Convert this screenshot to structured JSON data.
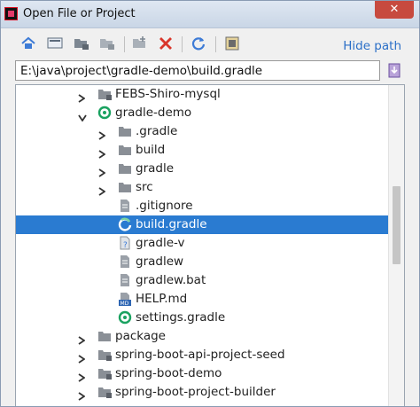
{
  "window": {
    "title": "Open File or Project",
    "close_symbol": "✕"
  },
  "toolbar": {
    "buttons": [
      {
        "name": "home-icon"
      },
      {
        "name": "desktop-icon"
      },
      {
        "name": "project-dir-icon"
      },
      {
        "name": "module-dir-icon"
      },
      {
        "name": "new-folder-icon"
      },
      {
        "name": "delete-icon"
      },
      {
        "name": "refresh-icon"
      },
      {
        "name": "show-hidden-icon"
      }
    ],
    "hide_path_label": "Hide path"
  },
  "path": {
    "value": "E:\\java\\project\\gradle-demo\\build.gradle"
  },
  "tree": {
    "rows": [
      {
        "label": "FEBS-Shiro-mysql",
        "icon": "folder-module-icon",
        "arrow": "right",
        "indent": 0
      },
      {
        "label": "gradle-demo",
        "icon": "gradle-project-icon",
        "arrow": "down",
        "indent": 0
      },
      {
        "label": ".gradle",
        "icon": "folder-icon",
        "arrow": "right",
        "indent": 1
      },
      {
        "label": "build",
        "icon": "folder-icon",
        "arrow": "right",
        "indent": 1
      },
      {
        "label": "gradle",
        "icon": "folder-icon",
        "arrow": "right",
        "indent": 1
      },
      {
        "label": "src",
        "icon": "folder-icon",
        "arrow": "right",
        "indent": 1
      },
      {
        "label": ".gitignore",
        "icon": "file-icon",
        "arrow": "none",
        "indent": 1
      },
      {
        "label": "build.gradle",
        "icon": "gradle-file-icon",
        "arrow": "none",
        "indent": 1,
        "selected": true
      },
      {
        "label": "gradle-v",
        "icon": "unknown-file-icon",
        "arrow": "none",
        "indent": 1
      },
      {
        "label": "gradlew",
        "icon": "file-icon",
        "arrow": "none",
        "indent": 1
      },
      {
        "label": "gradlew.bat",
        "icon": "file-icon",
        "arrow": "none",
        "indent": 1
      },
      {
        "label": "HELP.md",
        "icon": "markdown-file-icon",
        "arrow": "none",
        "indent": 1
      },
      {
        "label": "settings.gradle",
        "icon": "gradle-settings-icon",
        "arrow": "none",
        "indent": 1
      },
      {
        "label": "package",
        "icon": "folder-icon",
        "arrow": "right",
        "indent": 0
      },
      {
        "label": "spring-boot-api-project-seed",
        "icon": "folder-module-icon",
        "arrow": "right",
        "indent": 0
      },
      {
        "label": "spring-boot-demo",
        "icon": "folder-module-icon",
        "arrow": "right",
        "indent": 0
      },
      {
        "label": "spring-boot-project-builder",
        "icon": "folder-module-icon",
        "arrow": "right",
        "indent": 0
      }
    ]
  },
  "colors": {
    "selection": "#2a7bd1",
    "link": "#2b6fc7",
    "gradle_green": "#1aa260"
  }
}
